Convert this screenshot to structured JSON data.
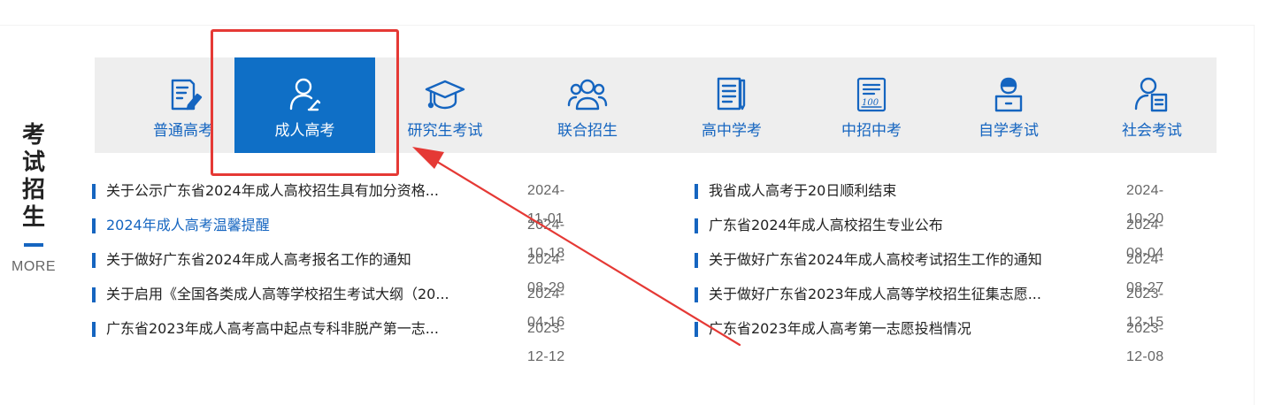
{
  "section": {
    "title_chars": [
      "考",
      "试",
      "招",
      "生"
    ],
    "more_label": "MORE"
  },
  "tabs": [
    {
      "label": "普通高考",
      "icon": "exam-paper-pen-icon",
      "active": false
    },
    {
      "label": "成人高考",
      "icon": "person-pen-icon",
      "active": true
    },
    {
      "label": "研究生考试",
      "icon": "graduation-cap-icon",
      "active": false
    },
    {
      "label": "联合招生",
      "icon": "group-people-icon",
      "active": false
    },
    {
      "label": "高中学考",
      "icon": "document-pen-icon",
      "active": false
    },
    {
      "label": "中招中考",
      "icon": "score-100-icon",
      "active": false
    },
    {
      "label": "自学考试",
      "icon": "person-computer-icon",
      "active": false
    },
    {
      "label": "社会考试",
      "icon": "person-document-icon",
      "active": false
    }
  ],
  "news_left": [
    {
      "title": "关于公示广东省2024年成人高校招生具有加分资格...",
      "date": "2024-11-01"
    },
    {
      "title": "2024年成人高考温馨提醒",
      "date": "2024-10-18",
      "highlighted": true
    },
    {
      "title": "关于做好广东省2024年成人高考报名工作的通知",
      "date": "2024-08-29"
    },
    {
      "title": "关于启用《全国各类成人高等学校招生考试大纲（20...",
      "date": "2024-04-16"
    },
    {
      "title": "广东省2023年成人高考高中起点专科非脱产第一志...",
      "date": "2023-12-12"
    }
  ],
  "news_right": [
    {
      "title": "我省成人高考于20日顺利结束",
      "date": "2024-10-20"
    },
    {
      "title": "广东省2024年成人高校招生专业公布",
      "date": "2024-09-04"
    },
    {
      "title": "关于做好广东省2024年成人高校考试招生工作的通知",
      "date": "2024-08-27"
    },
    {
      "title": "关于做好广东省2023年成人高等学校招生征集志愿...",
      "date": "2023-12-15"
    },
    {
      "title": "广东省2023年成人高考第一志愿投档情况",
      "date": "2023-12-08"
    }
  ],
  "colors": {
    "accent": "#0f6fc6",
    "link_blue": "#1565c0",
    "annotation_red": "#e53935",
    "tab_bar_bg": "#eeeeee"
  }
}
